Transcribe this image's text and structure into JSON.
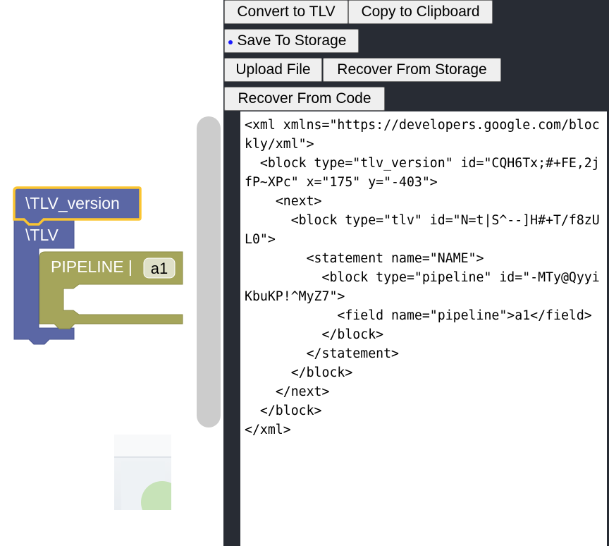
{
  "workspace": {
    "blocks": {
      "tlv_version_label": "\\TLV_version",
      "tlv_label": "\\TLV",
      "pipeline_label": "PIPELINE |",
      "pipeline_field_value": "a1"
    },
    "colors": {
      "tlv_block": "#5b67a5",
      "pipeline_block": "#a5a55b",
      "selection_outline": "#fbc531"
    }
  },
  "toolbar": {
    "convert_label": "Convert to TLV",
    "copy_label": "Copy to Clipboard",
    "save_label": "Save To Storage",
    "upload_label": "Upload File",
    "recover_storage_label": "Recover From Storage",
    "recover_code_label": "Recover From Code"
  },
  "editor": {
    "code": "<xml xmlns=\"https://developers.google.com/blockly/xml\">\n  <block type=\"tlv_version\" id=\"CQH6Tx;#+FE,2jfP~XPc\" x=\"175\" y=\"-403\">\n    <next>\n      <block type=\"tlv\" id=\"N=t|S^--]H#+T/f8zUL0\">\n        <statement name=\"NAME\">\n          <block type=\"pipeline\" id=\"-MTy@QyyiKbuKP!^MyZ7\">\n            <field name=\"pipeline\">a1</field>\n          </block>\n        </statement>\n      </block>\n    </next>\n  </block>\n</xml>"
  }
}
